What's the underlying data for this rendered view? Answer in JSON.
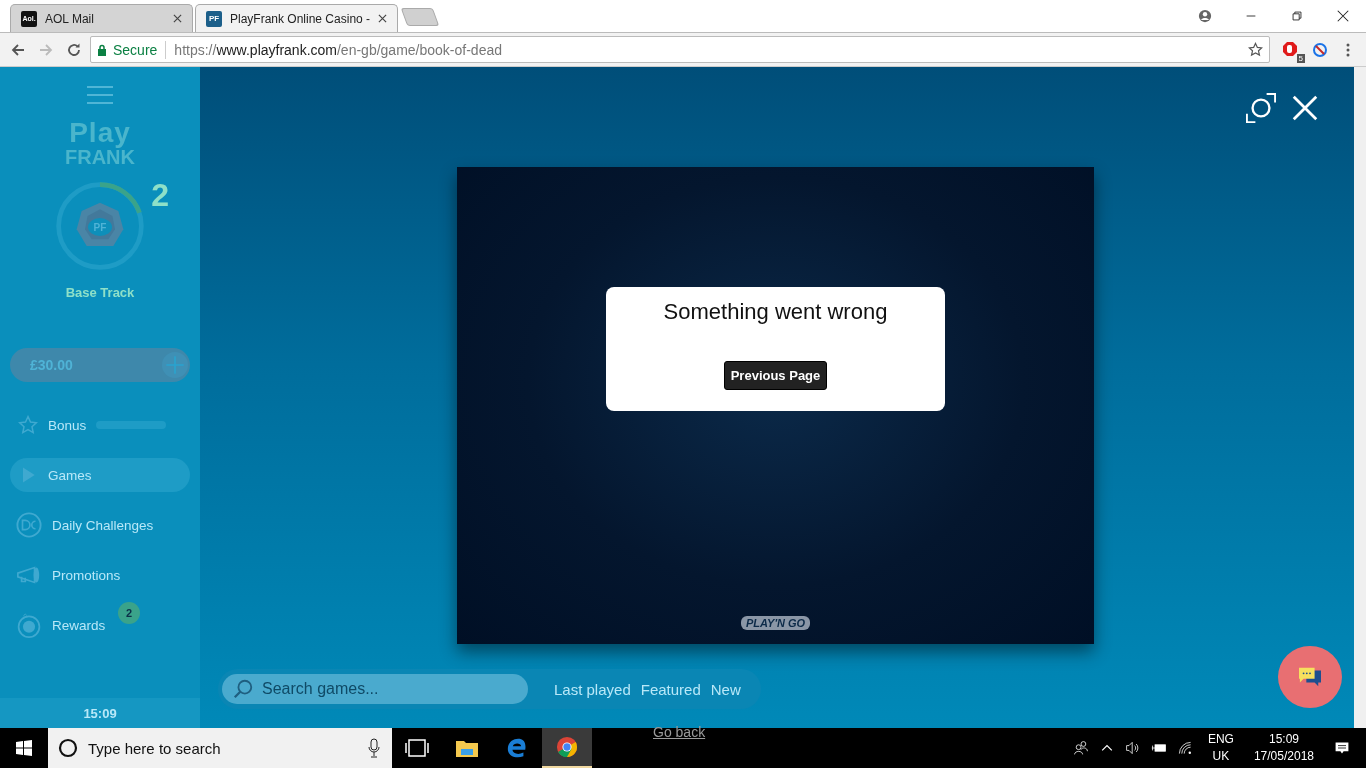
{
  "browser": {
    "tabs": [
      {
        "title": "AOL Mail",
        "favicon": "Aol.",
        "selected": false
      },
      {
        "title": "PlayFrank Online Casino -",
        "favicon": "PF",
        "selected": true
      }
    ],
    "security": "Secure",
    "url": {
      "scheme": "https://",
      "host": "www.playfrank.com",
      "path": "/en-gb/game/book-of-dead"
    },
    "extension_badge": "5"
  },
  "sidebar": {
    "logo": {
      "line_1": "Play",
      "line_2": "FRANK"
    },
    "level_badge": "PF",
    "level": "2",
    "track": "Base Track",
    "balance": "£30.00",
    "items": [
      {
        "label": "Bonus",
        "selected": false,
        "level": 0
      },
      {
        "label": "Games",
        "selected": true
      },
      {
        "label": "Daily Challenges",
        "selected": false
      },
      {
        "label": "Promotions",
        "selected": false
      },
      {
        "label": "Rewards",
        "selected": false,
        "badge": "2"
      }
    ],
    "time": "15:09"
  },
  "game": {
    "dialog": {
      "message": "Something went wrong",
      "button": "Previous Page"
    },
    "provider": "PLAY'N GO"
  },
  "search": {
    "placeholder": "Search games..."
  },
  "filters": [
    {
      "label": "Last played",
      "selected": false
    },
    {
      "label": "Featured",
      "selected": false
    },
    {
      "label": "New",
      "selected": false
    }
  ],
  "below_link": "Go back",
  "taskbar": {
    "search_placeholder": "Type here to search",
    "language": "ENG",
    "region": "UK",
    "time": "15:09",
    "date": "17/05/2018"
  }
}
